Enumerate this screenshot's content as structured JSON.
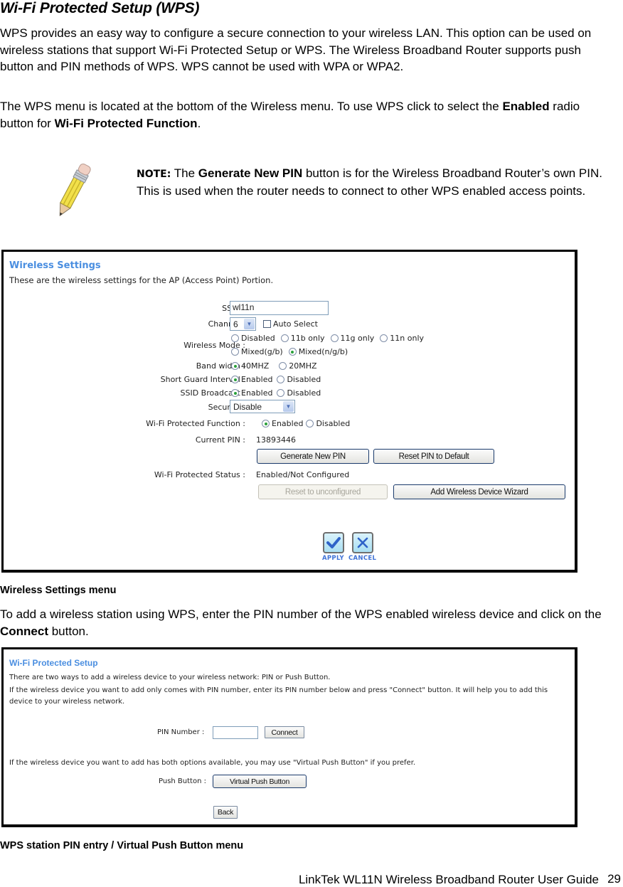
{
  "document": {
    "title": "Wi-Fi Protected Setup (WPS)",
    "intro_paragraph": "WPS provides an easy way to configure a secure connection to your wireless LAN. This option can be used on wireless stations that support Wi-Fi Protected Setup or WPS. The Wireless Broadband Router supports push button and PIN methods of WPS. WPS cannot be used with WPA or WPA2.",
    "instruction": {
      "pre": "The WPS menu is located at the bottom of the Wireless menu. To use WPS click to select the ",
      "bold1": "Enabled",
      "mid": " radio button for ",
      "bold2": "Wi-Fi Protected Function",
      "post": "."
    },
    "note": {
      "icon": "pencil-icon",
      "label": "NOTE:",
      "pre": " The ",
      "bold": "Generate New PIN",
      "post": " button is for the Wireless Broadband Router’s own PIN. This is used when the router needs to connect to other WPS enabled access points."
    },
    "caption1": "Wireless Settings menu",
    "connect_paragraph": {
      "pre": "To add a wireless station using WPS, enter the PIN number of the WPS enabled wireless device and click on the ",
      "bold": "Connect",
      "post": " button."
    },
    "caption2": "WPS station PIN entry / Virtual Push Button menu",
    "footer": "LinkTek WL11N Wireless Broadband Router User Guide",
    "page_number": "29"
  },
  "wireless_settings": {
    "title": "Wireless Settings",
    "subtitle": "These are the wireless settings for the AP (Access Point) Portion.",
    "ssid": {
      "label": "SSID :",
      "value": "wl11n"
    },
    "channel": {
      "label": "Channel :",
      "value": "6",
      "auto_select_label": "Auto Select",
      "auto_select_checked": false
    },
    "wireless_mode": {
      "label": "Wireless Mode :",
      "options": [
        "Disabled",
        "11b only",
        "11g only",
        "11n only",
        "Mixed(g/b)",
        "Mixed(n/g/b)"
      ],
      "selected": "Mixed(n/g/b)"
    },
    "band_width": {
      "label": "Band width :",
      "options": [
        "40MHZ",
        "20MHZ"
      ],
      "selected": "40MHZ"
    },
    "short_guard_interval": {
      "label": "Short Guard Interval :",
      "options": [
        "Enabled",
        "Disabled"
      ],
      "selected": "Enabled"
    },
    "ssid_broadcast": {
      "label": "SSID Broadcast :",
      "options": [
        "Enabled",
        "Disabled"
      ],
      "selected": "Enabled"
    },
    "security": {
      "label": "Security :",
      "value": "Disable"
    },
    "wps_function": {
      "label": "Wi-Fi Protected Function :",
      "options": [
        "Enabled",
        "Disabled"
      ],
      "selected": "Enabled"
    },
    "current_pin": {
      "label": "Current PIN :",
      "value": "13893446"
    },
    "generate_pin_button": "Generate New PIN",
    "reset_pin_button": "Reset PIN to Default",
    "wps_status": {
      "label": "Wi-Fi Protected Status :",
      "value": "Enabled/Not Configured"
    },
    "reset_unconfigured_button": "Reset to unconfigured",
    "add_wizard_button": "Add Wireless Device Wizard",
    "apply_label": "APPLY",
    "cancel_label": "CANCEL"
  },
  "wps_setup": {
    "title": "Wi-Fi Protected Setup",
    "line1": "There are two ways to add a wireless device to your wireless network: PIN or Push Button.",
    "line2": "If the wireless device you want to add only comes with PIN number, enter its PIN number below and press \"Connect\" button. It will help you to add this device to your wireless network.",
    "pin_label": "PIN Number :",
    "pin_value": "",
    "connect_button": "Connect",
    "line3": "If the wireless device you want to add has both options available, you may use \"Virtual Push Button\" if you prefer.",
    "push_label": "Push Button :",
    "virtual_push_button": "Virtual Push Button",
    "back_button": "Back"
  }
}
